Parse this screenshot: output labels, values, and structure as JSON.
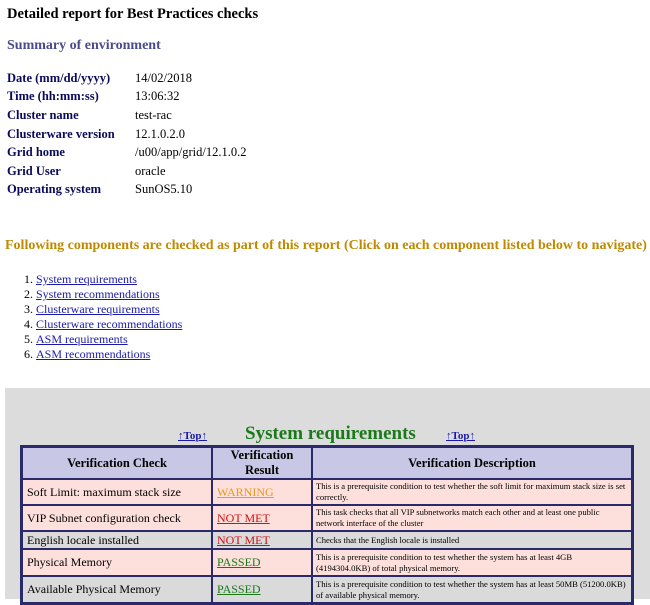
{
  "title": "Detailed report for Best Practices checks",
  "summary_heading": "Summary of environment",
  "environment": [
    {
      "key": "Date (mm/dd/yyyy)",
      "value": "14/02/2018"
    },
    {
      "key": "Time (hh:mm:ss)",
      "value": "13:06:32"
    },
    {
      "key": "Cluster name",
      "value": "test-rac"
    },
    {
      "key": "Clusterware version",
      "value": "12.1.0.2.0"
    },
    {
      "key": "Grid home",
      "value": "/u00/app/grid/12.1.0.2"
    },
    {
      "key": "Grid User",
      "value": "oracle"
    },
    {
      "key": "Operating system",
      "value": "SunOS5.10"
    }
  ],
  "components_heading": "Following components are checked as part of this report (Click on each component listed below to navigate)",
  "components": [
    {
      "num": "1.",
      "label": "System requirements"
    },
    {
      "num": "2.",
      "label": "System recommendations"
    },
    {
      "num": "3.",
      "label": "Clusterware requirements"
    },
    {
      "num": "4.",
      "label": "Clusterware recommendations"
    },
    {
      "num": "5.",
      "label": "ASM requirements"
    },
    {
      "num": "6.",
      "label": "ASM recommendations"
    }
  ],
  "section": {
    "top_link": "↑Top↑",
    "name": "System requirements",
    "headers": [
      "Verification Check",
      "Verification Result",
      "Verification Description"
    ],
    "rows": [
      {
        "check": "Soft Limit: maximum stack size",
        "result": "WARNING",
        "desc": "This is a prerequisite condition to test whether the soft limit for maximum stack size is set correctly."
      },
      {
        "check": "VIP Subnet configuration check",
        "result": "NOT MET",
        "desc": "This task checks that all VIP subnetworks match each other and at least one public network interface of the cluster"
      },
      {
        "check": "English locale installed",
        "result": "NOT MET",
        "desc": "Checks that the English locale is installed"
      },
      {
        "check": "Physical Memory",
        "result": "PASSED",
        "desc": "This is a prerequisite condition to test whether the system has at least 4GB (4194304.0KB) of total physical memory."
      },
      {
        "check": "Available Physical Memory",
        "result": "PASSED",
        "desc": "This is a prerequisite condition to test whether the system has at least 50MB (51200.0KB) of available physical memory."
      }
    ]
  },
  "colors": {
    "warning": "#e89a20",
    "not_met": "#d01010",
    "passed": "#1a7a1a",
    "section_title": "#1a7a1a",
    "components_heading": "#c08a00"
  }
}
